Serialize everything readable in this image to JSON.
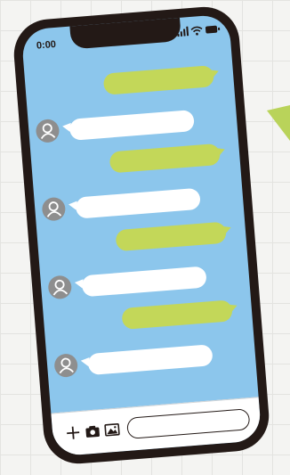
{
  "status_bar": {
    "time": "0:00",
    "icons": [
      "signal-icon",
      "wifi-icon",
      "battery-icon"
    ]
  },
  "chat": {
    "messages": [
      {
        "direction": "outgoing",
        "text": ""
      },
      {
        "direction": "incoming",
        "text": ""
      },
      {
        "direction": "outgoing",
        "text": ""
      },
      {
        "direction": "incoming",
        "text": ""
      },
      {
        "direction": "outgoing",
        "text": ""
      },
      {
        "direction": "incoming",
        "text": ""
      },
      {
        "direction": "outgoing",
        "text": ""
      },
      {
        "direction": "incoming",
        "text": ""
      }
    ]
  },
  "composer": {
    "actions": [
      "plus-icon",
      "camera-icon",
      "image-icon"
    ],
    "input_value": ""
  },
  "colors": {
    "background": "#f4f4f2",
    "phone_frame": "#231916",
    "screen": "#8cc6ec",
    "outgoing_bubble": "#c3d759",
    "incoming_bubble": "#ffffff",
    "avatar": "#8e8e8e",
    "accent_arrow": "#b9d35a"
  }
}
